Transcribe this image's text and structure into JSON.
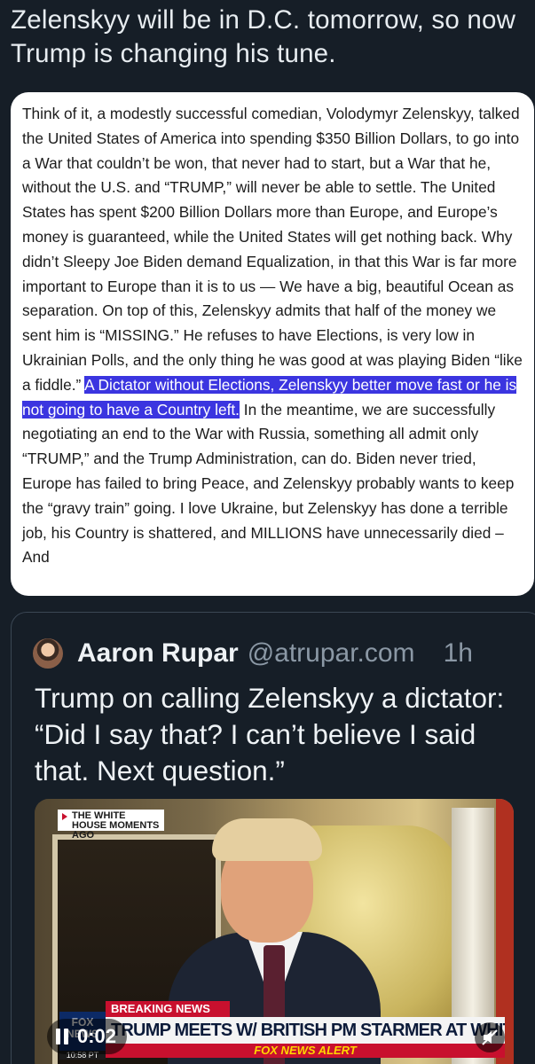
{
  "post": {
    "text": "Zelenskyy will be in D.C. tomorrow, so now Trump is changing his tune."
  },
  "screenshot": {
    "before_highlight": "Think of it, a modestly successful comedian, Volodymyr Zelenskyy, talked the United States of America into spending $350 Billion Dollars, to go into a War that couldn’t be won, that never had to start, but a War that he, without the U.S. and “TRUMP,” will never be able to settle. The United States has spent $200 Billion Dollars more than Europe, and Europe’s money is guaranteed, while the United States will get nothing back. Why didn’t Sleepy Joe Biden demand Equalization, in that this War is far more important to Europe than it is to us — We have a big, beautiful Ocean as separation. On top of this, Zelenskyy admits that half of the money we sent him is “MISSING.” He refuses to have Elections, is very low in Ukrainian Polls, and the only thing he was good at was playing Biden “like a fiddle.” ",
    "highlight": "A Dictator without Elections, Zelenskyy better move fast or he is not going to have a Country left.",
    "after_highlight": " In the meantime, we are successfully negotiating an end to the War with Russia, something all admit only “TRUMP,” and the Trump Administration, can do. Biden never tried, Europe has failed to bring Peace, and Zelenskyy probably wants to keep the “gravy train” going. I love Ukraine, but Zelenskyy has done a terrible job, his Country is shattered, and MILLIONS have unnecessarily died – And"
  },
  "quote": {
    "author_name": "Aaron Rupar",
    "author_handle": "@atrupar.com",
    "time_ago": "1h",
    "text": "Trump on calling Zelenskyy a dictator: “Did I say that? I can’t believe I said that. Next question.”",
    "video": {
      "time": "0:02",
      "lower_third": "THE WHITE HOUSE MOMENTS AGO",
      "breaking": "BREAKING NEWS",
      "headline": "TRUMP MEETS W/ BRITISH PM STARMER AT WHITE HOUSE",
      "alert": "FOX NEWS ALERT",
      "logo": "FOX NEWS",
      "clock": "10:58 PT"
    }
  },
  "icons": {
    "pause": "pause-icon",
    "mute": "mute-icon",
    "avatar": "avatar"
  },
  "colors": {
    "background": "#161e27",
    "highlight": "#3b35e0",
    "card": "#ffffff"
  }
}
